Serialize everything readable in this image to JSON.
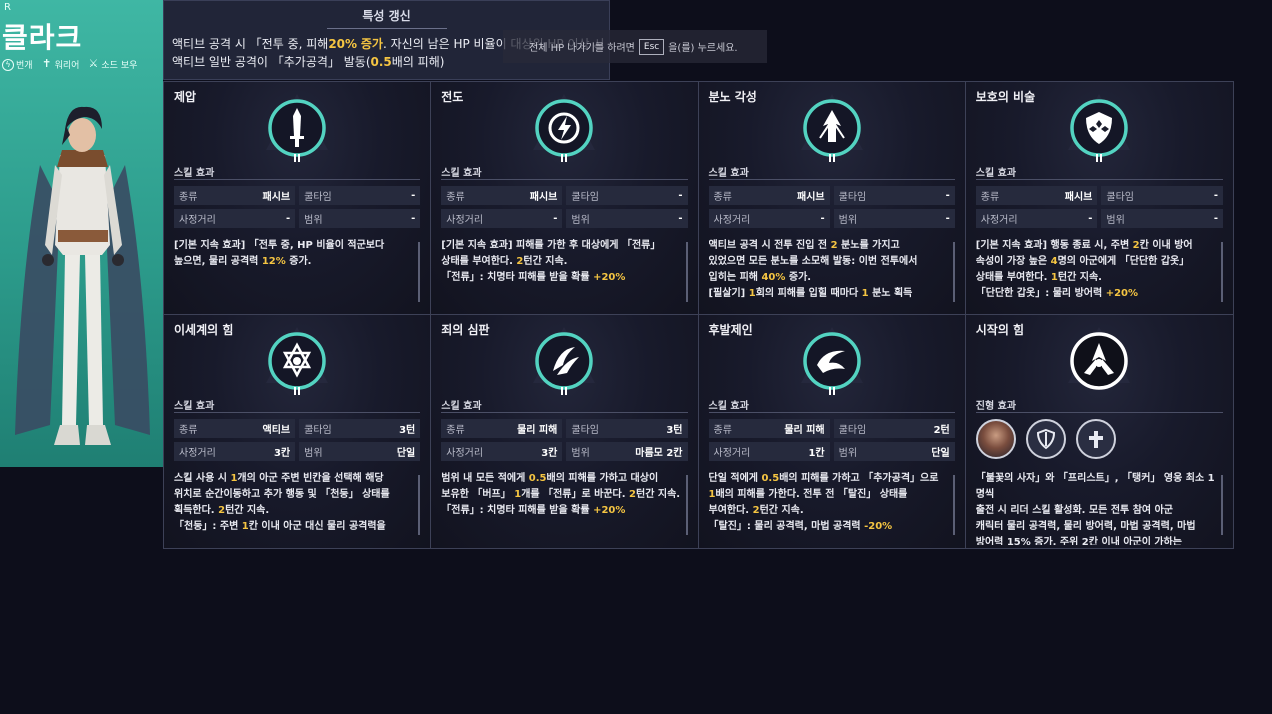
{
  "character": {
    "rarity": "R",
    "name": "클라크",
    "tags": [
      {
        "icon": "spiral-icon",
        "label": "번개"
      },
      {
        "icon": "cross-icon",
        "label": "워리어"
      },
      {
        "icon": "sword-icon",
        "label": "소드 보우"
      }
    ]
  },
  "trait": {
    "title": "특성 갱신",
    "line1_a": "액티브 공격 시 「전투 중, 피해",
    "line1_hl1": "20%",
    "line1_hl2": "증가",
    "line1_b": ". 자신의 남은 HP 비율이 대상위 HP 이상 시",
    "line2_a": "액티브 일반 공격이 「추가공격」 발동(",
    "line2_hl": "0.5",
    "line2_b": "배의 피해)"
  },
  "esc_hint": {
    "prefix": "전체 HP 나가기를 하려면",
    "key": "Esc",
    "suffix": "을(를) 누르세요."
  },
  "labels": {
    "skill_effect": "스킬 효과",
    "formation_effect": "진형 효과",
    "type": "종류",
    "cooldown": "쿨타임",
    "range": "사정거리",
    "area": "범위"
  },
  "skills": [
    {
      "name": "제압",
      "icon": "dagger-icon",
      "type": "패시브",
      "cooldown": "-",
      "range": "-",
      "area": "-",
      "desc": [
        [
          {
            "t": "[기본 지속 효과] 「전투 중, HP 비율이 적군보다"
          }
        ],
        [
          {
            "t": "높으면, 물리 공격력 "
          },
          {
            "t": "12%",
            "h": true
          },
          {
            "t": " 증가."
          }
        ]
      ]
    },
    {
      "name": "전도",
      "icon": "lightning-icon",
      "type": "패시브",
      "cooldown": "-",
      "range": "-",
      "area": "-",
      "desc": [
        [
          {
            "t": "[기본 지속 효과] 피해를 가한 후 대상에게 「전류」"
          }
        ],
        [
          {
            "t": "상태를 부여한다. "
          },
          {
            "t": "2",
            "h": true
          },
          {
            "t": "턴간 지속."
          }
        ],
        [
          {
            "t": "「전류」: 치명타 피해를 받을 확률 "
          },
          {
            "t": "+20%",
            "h": true
          }
        ]
      ]
    },
    {
      "name": "분노 각성",
      "icon": "arrow-up-icon",
      "type": "패시브",
      "cooldown": "-",
      "range": "-",
      "area": "-",
      "desc": [
        [
          {
            "t": "액티브 공격 시 전투 진입 전 "
          },
          {
            "t": "2",
            "h": true
          },
          {
            "t": " 분노를 가지고"
          }
        ],
        [
          {
            "t": "있었으면 모든 분노를 소모해 발동: 이번 전투에서"
          }
        ],
        [
          {
            "t": "입히는 피해 "
          },
          {
            "t": "40%",
            "h": true
          },
          {
            "t": " 증가."
          }
        ],
        [
          {
            "t": "[필살기] "
          },
          {
            "t": "1",
            "h": true
          },
          {
            "t": "회의 피해를 입힐 때마다 "
          },
          {
            "t": "1",
            "h": true
          },
          {
            "t": " 분노 획득"
          }
        ]
      ]
    },
    {
      "name": "보호의 비술",
      "icon": "shield-icon",
      "type": "패시브",
      "cooldown": "-",
      "range": "-",
      "area": "-",
      "desc": [
        [
          {
            "t": "[기본 지속 효과] 행동 종료 시, 주변 "
          },
          {
            "t": "2",
            "h": true
          },
          {
            "t": "칸 이내 방어"
          }
        ],
        [
          {
            "t": "속성이 가장 높은 "
          },
          {
            "t": "4",
            "h": true
          },
          {
            "t": "명의 아군에게 「단단한 갑옷」"
          }
        ],
        [
          {
            "t": "상태를 부여한다. "
          },
          {
            "t": "1",
            "h": true
          },
          {
            "t": "턴간 지속."
          }
        ],
        [
          {
            "t": "「단단한 갑옷」: 물리 방어력 "
          },
          {
            "t": "+20%",
            "h": true
          }
        ]
      ]
    },
    {
      "name": "이세계의 힘",
      "icon": "hexagram-icon",
      "type": "액티브",
      "cooldown": "3턴",
      "range": "3칸",
      "area": "단일",
      "desc": [
        [
          {
            "t": "스킬 사용 시 "
          },
          {
            "t": "1",
            "h": true
          },
          {
            "t": "개의 아군 주변 빈칸을 선택해 해당"
          }
        ],
        [
          {
            "t": "위치로 순간이동하고 추가 행동 및 「천둥」 상태를"
          }
        ],
        [
          {
            "t": "획득한다. "
          },
          {
            "t": "2",
            "h": true
          },
          {
            "t": "턴간 지속."
          }
        ],
        [
          {
            "t": "「천둥」: 주변 "
          },
          {
            "t": "1",
            "h": true
          },
          {
            "t": "칸 이내 아군 대신 물리 공격력을"
          }
        ]
      ]
    },
    {
      "name": "죄의 심판",
      "icon": "claw-icon",
      "type": "물리 피해",
      "cooldown": "3턴",
      "range": "3칸",
      "area": "마름모 2칸",
      "desc": [
        [
          {
            "t": "범위 내 모든 적에게 "
          },
          {
            "t": "0.5",
            "h": true
          },
          {
            "t": "배의 피해를 가하고 대상이"
          }
        ],
        [
          {
            "t": "보유한 「버프」 "
          },
          {
            "t": "1",
            "h": true
          },
          {
            "t": "개를 「전류」로 바꾼다. "
          },
          {
            "t": "2",
            "h": true
          },
          {
            "t": "턴간 지속."
          }
        ],
        [
          {
            "t": "「전류」: 치명타 피해를 받을 확률 "
          },
          {
            "t": "+20%",
            "h": true
          }
        ]
      ]
    },
    {
      "name": "후발제인",
      "icon": "swirl-icon",
      "type": "물리 피해",
      "cooldown": "2턴",
      "range": "1칸",
      "area": "단일",
      "desc": [
        [
          {
            "t": "단일 적에게 "
          },
          {
            "t": "0.5",
            "h": true
          },
          {
            "t": "배의 피해를 가하고 「추가공격」으로"
          }
        ],
        [
          {
            "t": "1",
            "h": true
          },
          {
            "t": "배의 피해를 가한다. 전투 전 「탈진」 상태를"
          }
        ],
        [
          {
            "t": "부여한다. "
          },
          {
            "t": "2",
            "h": true
          },
          {
            "t": "턴간 지속."
          }
        ],
        [
          {
            "t": "「탈진」: 물리 공격력, 마법 공격력 "
          },
          {
            "t": "-20%",
            "h": true
          }
        ]
      ]
    },
    {
      "name": "시작의 힘",
      "icon": "triskele-icon",
      "formation": [
        {
          "icon": "hero-portrait-icon"
        },
        {
          "icon": "shield-icon"
        },
        {
          "icon": "cross-icon"
        }
      ],
      "desc": [
        [
          {
            "t": "「불꽃의 사자」와 「프리스트」, 「탱커」 영웅 최소 1명씩"
          }
        ],
        [
          {
            "t": "출전 시 리더 스킬 활성화. 모든 전투 참여 아군"
          }
        ],
        [
          {
            "t": "캐릭터 물리 공격력, 물리 방어력, 마법 공격력, 마법"
          }
        ],
        [
          {
            "t": "방어력 15% 증가, 주위 2칸 이내 아군이 가하는"
          }
        ]
      ]
    }
  ],
  "colors": {
    "accent": "#f5c542",
    "teal_ring": "#53d3c1",
    "panel_bg": "#2c9b8b"
  }
}
